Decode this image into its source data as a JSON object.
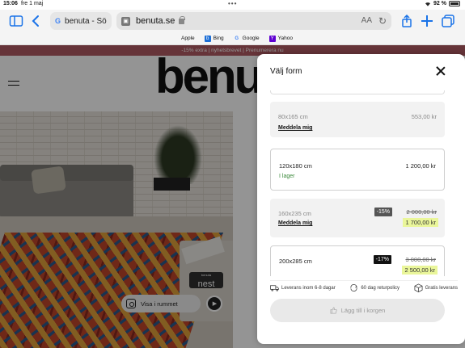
{
  "status": {
    "time": "15:06",
    "date": "fre 1 maj",
    "battery": "92 %"
  },
  "browser": {
    "tab_label": "benuta - Sö",
    "url": "benuta.se",
    "text_size_label": "AA",
    "favorites": [
      {
        "label": "Apple",
        "icon": "apple-icon"
      },
      {
        "label": "Bing",
        "icon": "bing-icon"
      },
      {
        "label": "Google",
        "icon": "google-icon"
      },
      {
        "label": "Yahoo",
        "icon": "yahoo-icon"
      }
    ]
  },
  "page": {
    "promo": "-15% extra | nyhetsbrevet | Prenumerera nu",
    "logo": "benu",
    "nest_small": "benuta",
    "nest_big": "nest",
    "visa_label": "Visa i rummet"
  },
  "drawer": {
    "title": "Välj form",
    "options": [
      {
        "size": "80x165 cm",
        "price": "553,00 kr",
        "sub": "Meddela mig",
        "style": "gray"
      },
      {
        "size": "120x180 cm",
        "price": "1 200,00 kr",
        "sub": "I lager",
        "style": "outlined"
      },
      {
        "size": "160x235 cm",
        "badge": "-15%",
        "old_price": "2 000,00 kr",
        "new_price": "1 700,00 kr",
        "sub": "Meddela mig",
        "style": "gray"
      },
      {
        "size": "200x285 cm",
        "badge": "-17%",
        "old_price": "3 000,00 kr",
        "new_price": "2 500,00 kr",
        "style": "outlined"
      }
    ],
    "usps": [
      "Leverans inom 6-8 dagar",
      "60 dag returpolicy",
      "Gratis leverans"
    ],
    "add_to_cart": "Lägg till i korgen"
  },
  "colors": {
    "promo_bg": "#b05b62",
    "accent_blue": "#1a73e8",
    "stock_green": "#3b8a3b",
    "price_highlight": "#eaf69a"
  }
}
